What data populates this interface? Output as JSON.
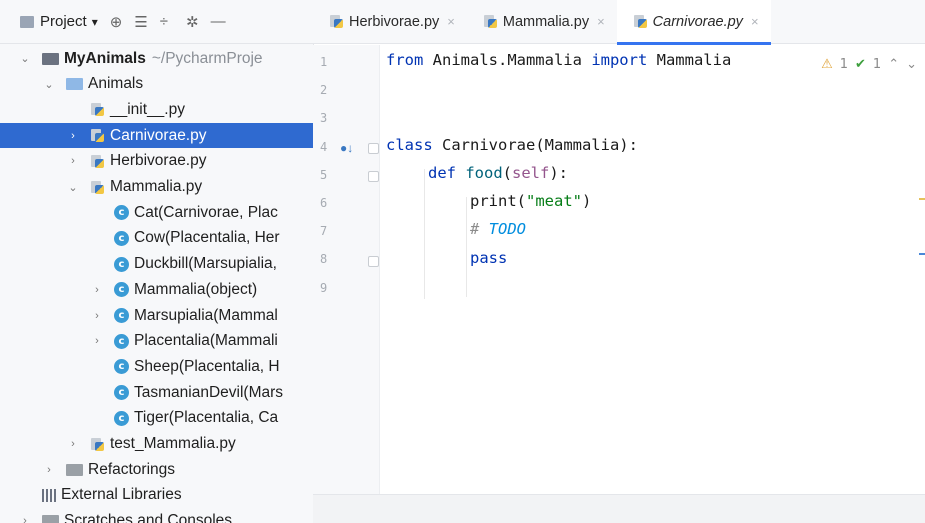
{
  "project_toolbar": {
    "label": "Project",
    "dropdown_glyph": "▾"
  },
  "tree": [
    {
      "indent": 0,
      "chevron": "⌄",
      "icon": "folder-dark",
      "label": "MyAnimals",
      "suffix": "~/PycharmProje",
      "bold": true
    },
    {
      "indent": 1,
      "chevron": "⌄",
      "icon": "folder-blue",
      "label": "Animals"
    },
    {
      "indent": 2,
      "chevron": "",
      "icon": "python-file",
      "label": "__init__.py"
    },
    {
      "indent": 2,
      "chevron": "›",
      "icon": "python-file",
      "label": "Carnivorae.py",
      "selected": true
    },
    {
      "indent": 2,
      "chevron": "›",
      "icon": "python-file",
      "label": "Herbivorae.py"
    },
    {
      "indent": 2,
      "chevron": "⌄",
      "icon": "python-file",
      "label": "Mammalia.py"
    },
    {
      "indent": 3,
      "chevron": "",
      "icon": "class",
      "label": "Cat(Carnivorae, Plac"
    },
    {
      "indent": 3,
      "chevron": "",
      "icon": "class",
      "label": "Cow(Placentalia, Her"
    },
    {
      "indent": 3,
      "chevron": "",
      "icon": "class",
      "label": "Duckbill(Marsupialia,"
    },
    {
      "indent": 3,
      "chevron": "›",
      "icon": "class",
      "label": "Mammalia(object)"
    },
    {
      "indent": 3,
      "chevron": "›",
      "icon": "class",
      "label": "Marsupialia(Mammal"
    },
    {
      "indent": 3,
      "chevron": "›",
      "icon": "class",
      "label": "Placentalia(Mammali"
    },
    {
      "indent": 3,
      "chevron": "",
      "icon": "class",
      "label": "Sheep(Placentalia, H"
    },
    {
      "indent": 3,
      "chevron": "",
      "icon": "class",
      "label": "TasmanianDevil(Mars"
    },
    {
      "indent": 3,
      "chevron": "",
      "icon": "class",
      "label": "Tiger(Placentalia, Ca"
    },
    {
      "indent": 2,
      "chevron": "›",
      "icon": "python-file",
      "label": "test_Mammalia.py"
    },
    {
      "indent": 1,
      "chevron": "›",
      "icon": "folder-gray",
      "label": "Refactorings"
    },
    {
      "indent": 0,
      "chevron": "",
      "icon": "libraries",
      "label": "External Libraries"
    },
    {
      "indent": 0,
      "chevron": "›",
      "icon": "folder-gray",
      "label": "Scratches and Consoles"
    }
  ],
  "tabs": [
    {
      "label": "Herbivorae.py",
      "active": false
    },
    {
      "label": "Mammalia.py",
      "active": false
    },
    {
      "label": "Carnivorae.py",
      "active": true
    }
  ],
  "line_numbers": [
    "1",
    "2",
    "3",
    "4",
    "5",
    "6",
    "7",
    "8",
    "9"
  ],
  "inspections": {
    "warnings": "1",
    "ok": "1"
  },
  "code": {
    "line1": {
      "kw1": "from",
      "mod": " Animals.Mammalia ",
      "kw2": "import",
      "name": " Mammalia"
    },
    "line4": {
      "kw": "class",
      "rest": " Carnivorae(Mammalia):"
    },
    "line5": {
      "kw": "def",
      "fn": "food",
      "open": "(",
      "self": "self",
      "close": "):"
    },
    "line6": {
      "fn": "print(",
      "str": "\"meat\"",
      "close": ")"
    },
    "line7": {
      "hash": "# ",
      "todo": "TODO"
    },
    "line8": {
      "kw": "pass"
    }
  }
}
